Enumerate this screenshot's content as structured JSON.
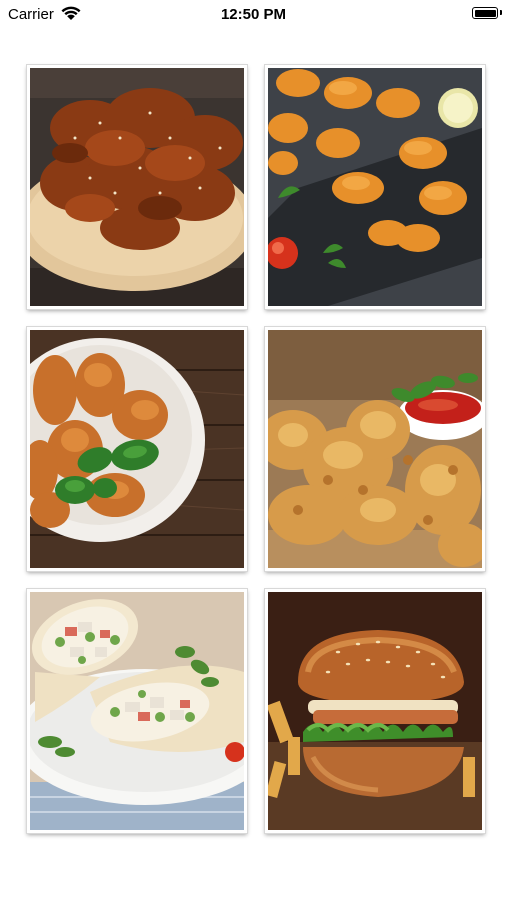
{
  "status_bar": {
    "carrier": "Carrier",
    "time": "12:50 PM",
    "icons": [
      "wifi-icon",
      "battery-icon"
    ]
  },
  "grid": {
    "items": [
      {
        "name": "food-image-chicken-wings",
        "subject": "glazed chicken wings with sesame on a wooden board"
      },
      {
        "name": "food-image-chicken-nuggets",
        "subject": "chicken nuggets on a slate board with tomato and lemon"
      },
      {
        "name": "food-image-fried-chicken-bowl",
        "subject": "breaded chicken pieces in a white bowl with basil"
      },
      {
        "name": "food-image-fried-chicken-sauce",
        "subject": "crispy fried chicken with dipping sauce"
      },
      {
        "name": "food-image-wraps",
        "subject": "vegetable chicken wraps on a plate"
      },
      {
        "name": "food-image-burger",
        "subject": "sesame bun burger with lettuce and fries"
      }
    ]
  }
}
